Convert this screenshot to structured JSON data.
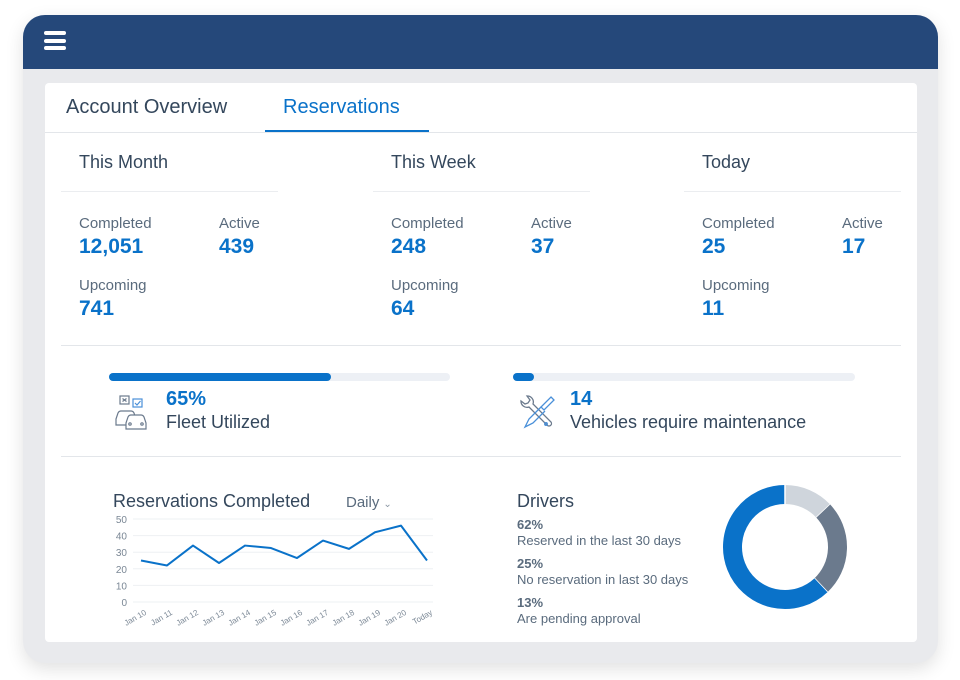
{
  "header": {
    "menu_icon": "hamburger-menu-icon"
  },
  "tabs": [
    {
      "label": "Account Overview",
      "active": false
    },
    {
      "label": "Reservations",
      "active": true
    }
  ],
  "periods": [
    {
      "title": "This Month",
      "completed_label": "Completed",
      "completed": "12,051",
      "active_label": "Active",
      "active": "439",
      "upcoming_label": "Upcoming",
      "upcoming": "741"
    },
    {
      "title": "This Week",
      "completed_label": "Completed",
      "completed": "248",
      "active_label": "Active",
      "active": "37",
      "upcoming_label": "Upcoming",
      "upcoming": "64"
    },
    {
      "title": "Today",
      "completed_label": "Completed",
      "completed": "25",
      "active_label": "Active",
      "active": "17",
      "upcoming_label": "Upcoming",
      "upcoming": "11"
    }
  ],
  "fleet": {
    "value": "65%",
    "label": "Fleet Utilized",
    "progress": 0.65,
    "icon": "fleet-cars-icon"
  },
  "maintenance": {
    "value": "14",
    "label": "Vehicles require maintenance",
    "progress": 0.06,
    "icon": "wrench-screwdriver-icon"
  },
  "colors": {
    "accent": "#0a72c9",
    "header": "#25487a",
    "donut_gray_dark": "#6b7a8d",
    "donut_gray_light": "#cfd5dc"
  },
  "reservations_chart": {
    "title": "Reservations Completed",
    "period_select": "Daily"
  },
  "drivers": {
    "title": "Drivers",
    "items": [
      {
        "percent": "62%",
        "label": "Reserved in the last 30 days"
      },
      {
        "percent": "25%",
        "label": "No reservation in last 30 days"
      },
      {
        "percent": "13%",
        "label": "Are pending approval"
      }
    ]
  },
  "chart_data": [
    {
      "type": "line",
      "title": "Reservations Completed",
      "categories": [
        "Jan 10",
        "Jan 11",
        "Jan 12",
        "Jan 13",
        "Jan 14",
        "Jan 15",
        "Jan 16",
        "Jan 17",
        "Jan 18",
        "Jan 19",
        "Jan 20",
        "Today"
      ],
      "series": [
        {
          "name": "Reservations Completed",
          "values": [
            25,
            22,
            34,
            23.5,
            34,
            32.5,
            26.5,
            37,
            32,
            42,
            46,
            25
          ]
        }
      ],
      "yticks": [
        0,
        10,
        20,
        30,
        40,
        50
      ],
      "ylim": [
        0,
        50
      ],
      "grid": true,
      "xlabel": "",
      "ylabel": ""
    },
    {
      "type": "pie",
      "title": "Drivers",
      "categories": [
        "Are pending approval",
        "No reservation in last 30 days",
        "Reserved in the last 30 days"
      ],
      "values": [
        13,
        25,
        62
      ],
      "colors": [
        "#cfd5dc",
        "#6b7a8d",
        "#0a72c9"
      ],
      "donut": true
    }
  ]
}
